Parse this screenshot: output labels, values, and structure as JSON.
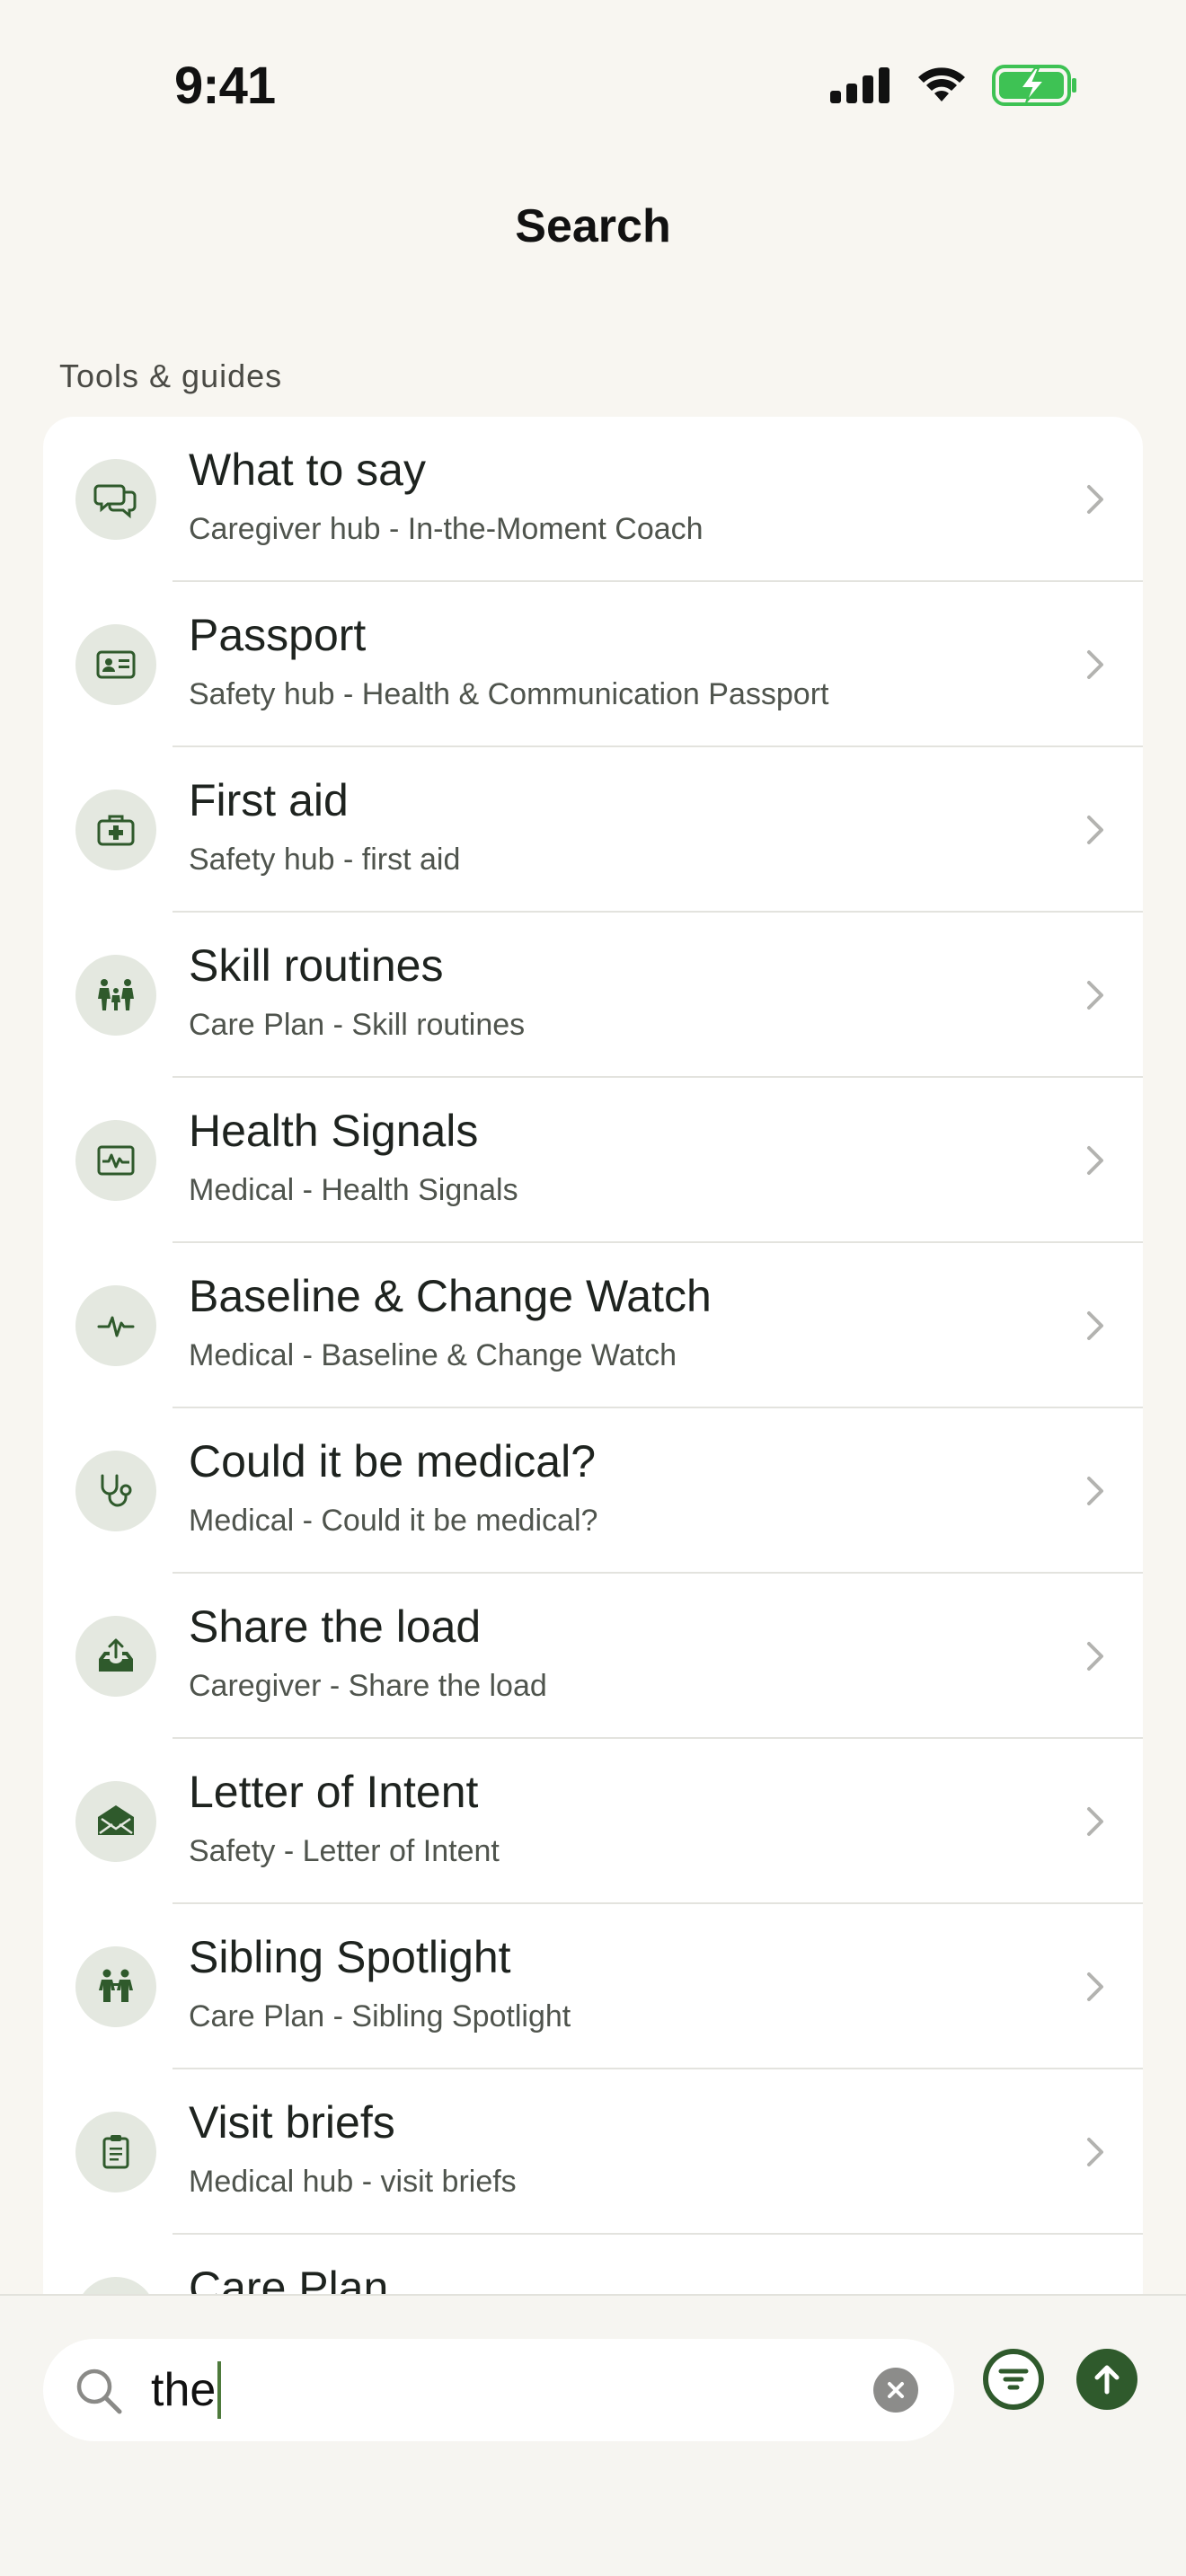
{
  "status_bar": {
    "time": "9:41"
  },
  "header": {
    "title": "Search"
  },
  "section": {
    "label": "Tools & guides"
  },
  "results": [
    {
      "title": "What to say",
      "subtitle": "Caregiver hub - In-the-Moment Coach",
      "icon": "chat-bubbles-icon"
    },
    {
      "title": "Passport",
      "subtitle": "Safety hub - Health & Communication Passport",
      "icon": "id-card-icon"
    },
    {
      "title": "First aid",
      "subtitle": "Safety hub - first aid",
      "icon": "first-aid-kit-icon"
    },
    {
      "title": "Skill routines",
      "subtitle": "Care Plan - Skill routines",
      "icon": "family-icon"
    },
    {
      "title": "Health Signals",
      "subtitle": "Medical - Health Signals",
      "icon": "monitor-pulse-icon"
    },
    {
      "title": "Baseline & Change Watch",
      "subtitle": "Medical - Baseline & Change Watch",
      "icon": "pulse-icon"
    },
    {
      "title": "Could it be medical?",
      "subtitle": "Medical - Could it be medical?",
      "icon": "stethoscope-icon"
    },
    {
      "title": "Share the load",
      "subtitle": "Caregiver - Share the load",
      "icon": "tray-upload-icon"
    },
    {
      "title": "Letter of Intent",
      "subtitle": "Safety - Letter of Intent",
      "icon": "envelope-open-icon"
    },
    {
      "title": "Sibling Spotlight",
      "subtitle": "Care Plan - Sibling Spotlight",
      "icon": "siblings-icon"
    },
    {
      "title": "Visit briefs",
      "subtitle": "Medical hub - visit briefs",
      "icon": "clipboard-icon"
    },
    {
      "title": "Care Plan",
      "subtitle": "",
      "icon": "care-plan-icon"
    }
  ],
  "search": {
    "value": "the"
  },
  "colors": {
    "accent": "#2f5a2c",
    "background": "#f8f6f1",
    "icon_bg": "#e4e8e0"
  }
}
